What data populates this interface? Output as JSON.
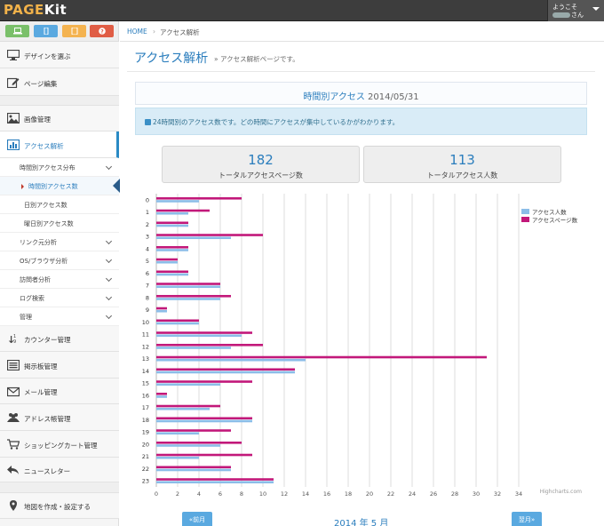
{
  "app": {
    "logo_page": "PAGE",
    "logo_kit": "Kit"
  },
  "user": {
    "welcome": "ようこそ",
    "suffix": "さん"
  },
  "quick_buttons": [
    {
      "icon": "laptop-icon",
      "color": "#7ac06a"
    },
    {
      "icon": "mobile-icon",
      "color": "#5aa9e0"
    },
    {
      "icon": "tablet-icon",
      "color": "#f4b350"
    },
    {
      "icon": "help-icon",
      "color": "#e05d45"
    }
  ],
  "sidebar": {
    "items": [
      {
        "label": "デザインを選ぶ",
        "icon": "monitor-icon"
      },
      {
        "label": "ページ編集",
        "icon": "edit-icon"
      },
      {
        "label": "画像管理",
        "icon": "image-icon"
      },
      {
        "label": "アクセス解析",
        "icon": "bar-chart-icon"
      },
      {
        "label": "カウンター管理",
        "icon": "counter-icon"
      },
      {
        "label": "掲示板管理",
        "icon": "board-icon"
      },
      {
        "label": "メール管理",
        "icon": "mail-icon"
      },
      {
        "label": "アドレス帳管理",
        "icon": "users-icon"
      },
      {
        "label": "ショッピングカート管理",
        "icon": "cart-icon"
      },
      {
        "label": "ニュースレター",
        "icon": "reply-icon"
      },
      {
        "label": "地図を作成・設定する",
        "icon": "map-pin-icon"
      }
    ],
    "subitems": [
      {
        "label": "時間別アクセス分布"
      },
      {
        "label": "時間別アクセス数"
      },
      {
        "label": "日別アクセス数"
      },
      {
        "label": "曜日別アクセス数"
      },
      {
        "label": "リンク元分析"
      },
      {
        "label": "OS/ブラウザ分析"
      },
      {
        "label": "訪問者分析"
      },
      {
        "label": "ログ検索"
      },
      {
        "label": "管理"
      }
    ]
  },
  "breadcrumb": {
    "home": "HOME",
    "sep": "›",
    "current": "アクセス解析"
  },
  "page": {
    "title": "アクセス解析",
    "subtitle": "» アクセス解析ページです。"
  },
  "panel": {
    "title": "時間別アクセス",
    "date": "2014/05/31",
    "info": "24時間別のアクセス数です。どの時間にアクセスが集中しているかがわかります。"
  },
  "stats": [
    {
      "value": "182",
      "label": "トータルアクセスページ数"
    },
    {
      "value": "113",
      "label": "トータルアクセス人数"
    }
  ],
  "chart_data": {
    "type": "bar",
    "orientation": "horizontal",
    "categories": [
      "0",
      "1",
      "2",
      "3",
      "4",
      "5",
      "6",
      "7",
      "8",
      "9",
      "10",
      "11",
      "12",
      "13",
      "14",
      "15",
      "16",
      "17",
      "18",
      "19",
      "20",
      "21",
      "22",
      "23"
    ],
    "series": [
      {
        "name": "アクセス人数",
        "color": "#8bbde8",
        "values": [
          4,
          3,
          3,
          7,
          3,
          2,
          3,
          6,
          6,
          1,
          4,
          8,
          7,
          14,
          13,
          6,
          1,
          5,
          9,
          4,
          6,
          4,
          7,
          11
        ]
      },
      {
        "name": "アクセスページ数",
        "color": "#c2187a",
        "values": [
          8,
          5,
          3,
          10,
          3,
          2,
          3,
          6,
          7,
          1,
          4,
          9,
          10,
          31,
          13,
          9,
          1,
          6,
          9,
          7,
          8,
          9,
          7,
          11
        ]
      }
    ],
    "xlim": [
      0,
      36
    ],
    "xticks": [
      0,
      2,
      4,
      6,
      8,
      10,
      12,
      14,
      16,
      18,
      20,
      22,
      24,
      26,
      28,
      30,
      32,
      34
    ],
    "grid": true,
    "legend": "top-right",
    "credit": "Highcharts.com"
  },
  "footer": {
    "prev": "«前月",
    "next": "翌月»",
    "month": "2014 年  5 月"
  }
}
